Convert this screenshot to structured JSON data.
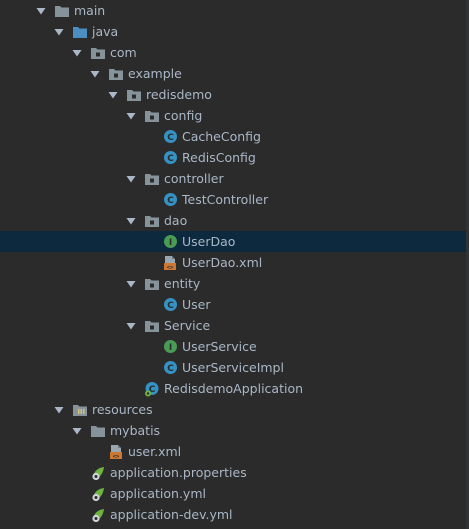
{
  "project_tree": {
    "items": [
      {
        "label": "main",
        "icon": "folder-icon",
        "expanded": true,
        "level": 0
      },
      {
        "label": "java",
        "icon": "source-root-folder-icon",
        "expanded": true,
        "level": 1
      },
      {
        "label": "com",
        "icon": "package-icon",
        "expanded": true,
        "level": 2
      },
      {
        "label": "example",
        "icon": "package-icon",
        "expanded": true,
        "level": 3
      },
      {
        "label": "redisdemo",
        "icon": "package-icon",
        "expanded": true,
        "level": 4
      },
      {
        "label": "config",
        "icon": "package-icon",
        "expanded": true,
        "level": 5
      },
      {
        "label": "CacheConfig",
        "icon": "java-class-icon",
        "level": 6
      },
      {
        "label": "RedisConfig",
        "icon": "java-class-icon",
        "level": 6
      },
      {
        "label": "controller",
        "icon": "package-icon",
        "expanded": true,
        "level": 5
      },
      {
        "label": "TestController",
        "icon": "java-class-icon",
        "level": 6
      },
      {
        "label": "dao",
        "icon": "package-icon",
        "expanded": true,
        "level": 5
      },
      {
        "label": "UserDao",
        "icon": "java-interface-icon",
        "level": 6,
        "selected": true
      },
      {
        "label": "UserDao.xml",
        "icon": "xml-file-icon",
        "level": 6
      },
      {
        "label": "entity",
        "icon": "package-icon",
        "expanded": true,
        "level": 5
      },
      {
        "label": "User",
        "icon": "java-class-icon",
        "level": 6
      },
      {
        "label": "Service",
        "icon": "package-icon",
        "expanded": true,
        "level": 5
      },
      {
        "label": "UserService",
        "icon": "java-interface-icon",
        "level": 6
      },
      {
        "label": "UserServiceImpl",
        "icon": "java-class-icon",
        "level": 6
      },
      {
        "label": "RedisdemoApplication",
        "icon": "spring-boot-class-icon",
        "level": 5
      },
      {
        "label": "resources",
        "icon": "resources-folder-icon",
        "expanded": true,
        "level": 1
      },
      {
        "label": "mybatis",
        "icon": "folder-icon",
        "expanded": true,
        "level": 2
      },
      {
        "label": "user.xml",
        "icon": "xml-file-icon",
        "level": 3
      },
      {
        "label": "application.properties",
        "icon": "spring-config-file-icon",
        "level": 2
      },
      {
        "label": "application.yml",
        "icon": "spring-config-file-icon",
        "level": 2
      },
      {
        "label": "application-dev.yml",
        "icon": "spring-config-file-icon",
        "level": 2
      }
    ]
  },
  "colors": {
    "background": "#2b2b2b",
    "selection": "#0d293e",
    "text": "#a9b7c6",
    "class_icon": "#3592c4",
    "interface_icon": "#499c54",
    "folder": "#87939a",
    "source_folder": "#4a8ec2",
    "xml_icon": "#cc7832",
    "spring_leaf": "#6db33f"
  }
}
